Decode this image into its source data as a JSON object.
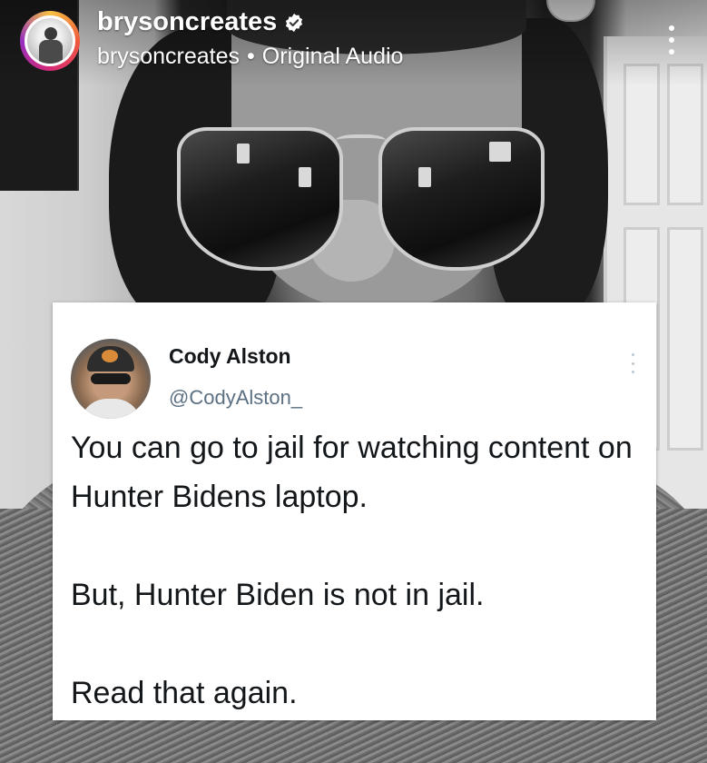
{
  "header": {
    "username": "brysoncreates",
    "audio_owner": "brysoncreates",
    "separator": "•",
    "audio_label": "Original Audio"
  },
  "icons": {
    "verified": "verified-badge-icon",
    "more": "more-vertical-icon"
  },
  "colors": {
    "story_ring": [
      "#f7c242",
      "#f05a3c",
      "#d62976",
      "#962fbf"
    ],
    "handle_gray": "#5b7083"
  },
  "tweet": {
    "name": "Cody Alston",
    "handle": "@CodyAlston_",
    "paragraphs": [
      "You can go to jail for watching content on Hunter Bidens laptop.",
      "But, Hunter Biden is not in jail.",
      "Read that again."
    ]
  }
}
